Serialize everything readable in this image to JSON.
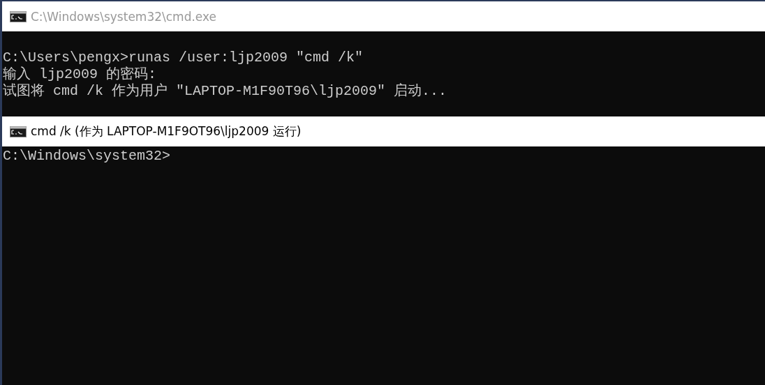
{
  "windows": [
    {
      "title": "C:\\Windows\\system32\\cmd.exe",
      "active": false,
      "lines": [
        "C:\\Users\\pengx>runas /user:ljp2009 \"cmd /k\"",
        "输入 ljp2009 的密码:",
        "试图将 cmd /k 作为用户 \"LAPTOP-M1F90T96\\ljp2009\" 启动..."
      ]
    },
    {
      "title": "cmd /k (作为 LAPTOP-M1F9OT96\\ljp2009 运行)",
      "active": true,
      "lines": [
        "C:\\Windows\\system32>"
      ]
    }
  ]
}
